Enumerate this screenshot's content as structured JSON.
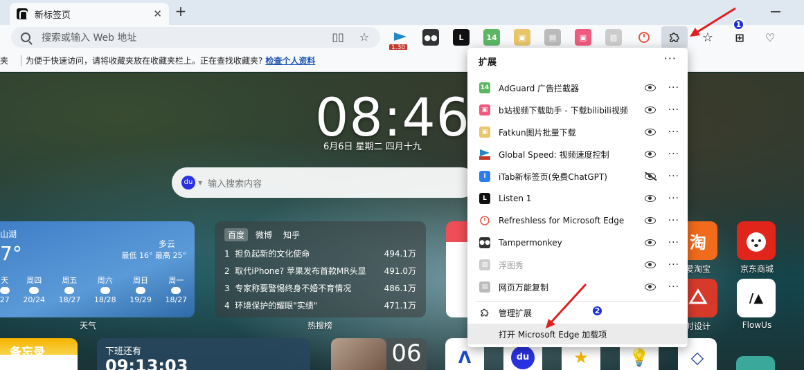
{
  "tab": {
    "title": "新标签页",
    "close": "✕",
    "new": "+"
  },
  "omnibox": {
    "placeholder": "搜索或输入 Web 地址"
  },
  "ext_badges": {
    "speed": "1.30"
  },
  "favbar": {
    "cut": "夹",
    "text": "为便于快速访问，请将收藏夹放在收藏夹栏上。正在查找收藏夹?",
    "link": "检查个人资料"
  },
  "clock": {
    "time": "08:46",
    "date": "6月6日  星期二  四月十九"
  },
  "search": {
    "placeholder": "输入搜索内容"
  },
  "weather": {
    "location": "山湖",
    "temp": "7°",
    "condition": "多云",
    "range": "最低 16° 最高 25°",
    "days": [
      {
        "name": "天",
        "range": "27"
      },
      {
        "name": "周四",
        "range": "20/24"
      },
      {
        "name": "周五",
        "range": "18/27"
      },
      {
        "name": "周六",
        "range": "18/28"
      },
      {
        "name": "周日",
        "range": "19/29"
      },
      {
        "name": "周一",
        "range": "18/27"
      }
    ],
    "label": "天气"
  },
  "hot": {
    "tabs": [
      "百度",
      "微博",
      "知乎"
    ],
    "rows": [
      {
        "rank": "1",
        "title": "担负起新的文化使命",
        "count": "494.1万"
      },
      {
        "rank": "2",
        "title": "取代iPhone? 苹果发布首款MR头显",
        "count": "491.0万"
      },
      {
        "rank": "3",
        "title": "专家称要警惕终身不婚不育情况",
        "count": "486.1万"
      },
      {
        "rank": "4",
        "title": "环境保护的耀眼\"实绩\"",
        "count": "471.1万"
      }
    ],
    "label": "热搜榜"
  },
  "memo": {
    "title": "备忘录"
  },
  "offwork": {
    "title": "下班还有",
    "countdown": "09:13:03"
  },
  "calendar": {
    "day": "06"
  },
  "apps": {
    "taobao_label": "爱淘宝",
    "jd_label": "京东商城",
    "design_label": "时设计",
    "flowus_label": "FlowUs",
    "taobao_glyph": "淘",
    "flowus_glyph": "/▲"
  },
  "menu": {
    "title": "扩展",
    "more": "···",
    "items": [
      {
        "name": "AdGuard 广告拦截器",
        "visible": true
      },
      {
        "name": "b站视频下载助手 - 下载bilibili视频",
        "visible": true
      },
      {
        "name": "Fatkun图片批量下载",
        "visible": true
      },
      {
        "name": "Global Speed: 视频速度控制",
        "visible": true
      },
      {
        "name": "iTab新标签页(免费ChatGPT)",
        "visible": false
      },
      {
        "name": "Listen 1",
        "visible": true
      },
      {
        "name": "Refreshless for Microsoft Edge",
        "visible": true
      },
      {
        "name": "Tampermonkey",
        "visible": true
      },
      {
        "name": "浮图秀",
        "visible": true
      },
      {
        "name": "网页万能复制",
        "visible": true
      }
    ],
    "manage": "管理扩展",
    "open_addons": "打开 Microsoft Edge 加载项"
  },
  "annotations": {
    "one": "1",
    "two": "2"
  },
  "colors": {
    "arrow": "#e02020",
    "accent": "#1c2fd6"
  }
}
